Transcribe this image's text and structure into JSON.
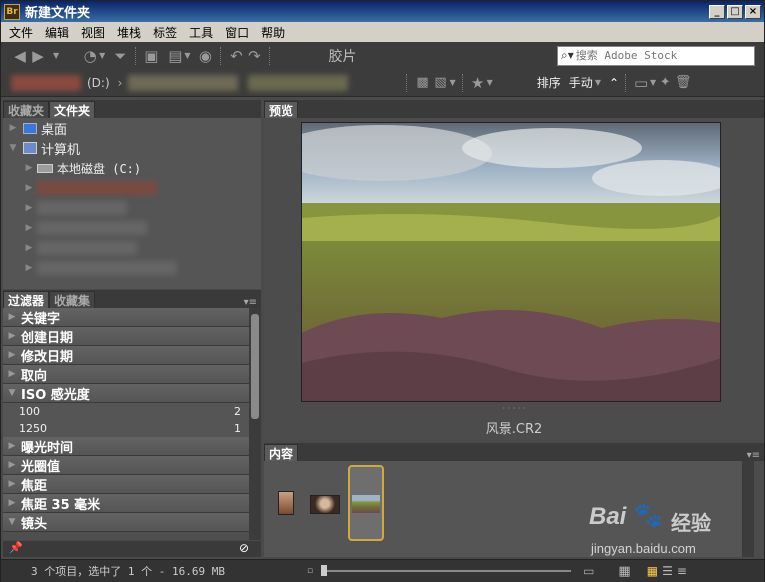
{
  "window": {
    "app_icon": "Br",
    "title": "新建文件夹",
    "min": "_",
    "max": "□",
    "close": "×"
  },
  "menu": [
    "文件",
    "编辑",
    "视图",
    "堆栈",
    "标签",
    "工具",
    "窗口",
    "帮助"
  ],
  "toolbar": {
    "workspace": "胶片",
    "search_placeholder": "搜索 Adobe Stock"
  },
  "path": {
    "drive": "(D:)",
    "sort_label": "排序",
    "sort_value": "手动"
  },
  "left_tabs": {
    "favorites": "收藏夹",
    "folders": "文件夹"
  },
  "tree": {
    "desktop": "桌面",
    "computer": "计算机",
    "local_disk": "本地磁盘 (C:)"
  },
  "filter_tabs": {
    "filter": "过滤器",
    "collections": "收藏集"
  },
  "filters": [
    {
      "label": "关键字",
      "open": false
    },
    {
      "label": "创建日期",
      "open": false
    },
    {
      "label": "修改日期",
      "open": false
    },
    {
      "label": "取向",
      "open": false
    },
    {
      "label": "ISO 感光度",
      "open": true
    }
  ],
  "iso_values": [
    {
      "value": "100",
      "count": "2"
    },
    {
      "value": "1250",
      "count": "1"
    }
  ],
  "filters_after": [
    {
      "label": "曝光时间"
    },
    {
      "label": "光圈值"
    },
    {
      "label": "焦距"
    },
    {
      "label": "焦距 35 毫米"
    },
    {
      "label": "镜头"
    }
  ],
  "preview": {
    "tab": "预览",
    "filename": "风景.CR2",
    "dots": "· · · · ·"
  },
  "content": {
    "tab": "内容"
  },
  "status": {
    "text": "3 个项目，选中了 1 个 - 16.69 MB"
  },
  "watermark": {
    "brand": "Bai",
    "brand2": "经验",
    "url": "jingyan.baidu.com"
  }
}
